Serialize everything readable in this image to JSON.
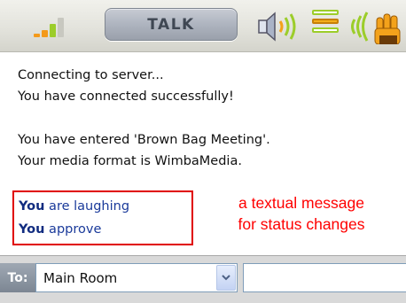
{
  "toolbar": {
    "talk_label": "TALK",
    "icons": [
      "mic-level-icon",
      "speaker-volume-icon",
      "status-bars-icon",
      "signal-hand-icon"
    ]
  },
  "messages": {
    "lines": [
      "Connecting to server...",
      "You have connected successfully!",
      "You have entered 'Brown Bag Meeting'.",
      "Your media format is WimbaMedia."
    ],
    "status": [
      {
        "who": "You",
        "text": " are laughing"
      },
      {
        "who": "You",
        "text": " approve"
      }
    ],
    "annotation": [
      "a textual message",
      "for status changes"
    ]
  },
  "bottom": {
    "to_label": "To:",
    "recipient": "Main Room",
    "message_value": ""
  },
  "colors": {
    "annotation": "#ff0000",
    "status_text": "#1a3a9a",
    "status_box_border": "#e00000",
    "level_green": "#9ccd2a",
    "level_orange": "#f49a1a"
  }
}
